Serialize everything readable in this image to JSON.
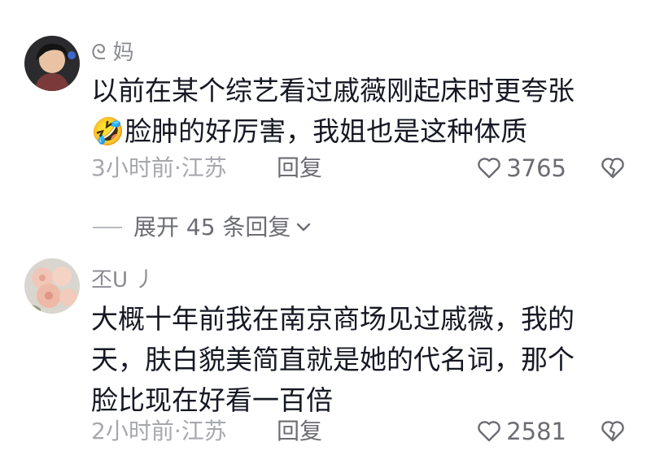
{
  "comments": [
    {
      "username": "ᘓ 妈",
      "text_line1": "以前在某个综艺看过戚薇刚起床时更夸张",
      "emoji": "🤣",
      "text_line2": "脸肿的好厉害，我姐也是这种体质",
      "meta": "3小时前·江苏",
      "reply_label": "回复",
      "likes": "3765"
    },
    {
      "username": "丕U 丿",
      "text_line1": "大概十年前我在南京商场见过戚薇，我的",
      "text_line2": "天，肤白貌美简直就是她的代名词，那个",
      "text_line3": "脸比现在好看一百倍",
      "meta": "2小时前·江苏",
      "reply_label": "回复",
      "likes": "2581"
    }
  ],
  "expand_replies": {
    "label": "展开 45 条回复"
  }
}
